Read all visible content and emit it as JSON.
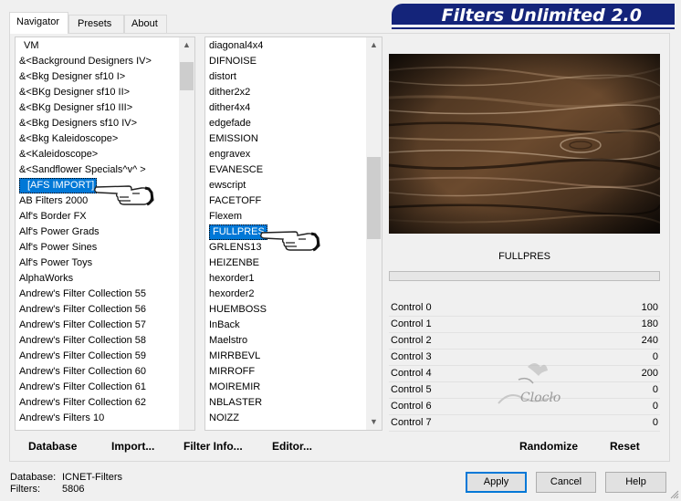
{
  "app": {
    "title": "Filters Unlimited 2.0"
  },
  "tabs": [
    {
      "label": "Navigator",
      "active": true
    },
    {
      "label": "Presets",
      "active": false
    },
    {
      "label": "About",
      "active": false
    }
  ],
  "categories": {
    "items": [
      "VM",
      "&<Background Designers IV>",
      "&<Bkg Designer sf10 I>",
      "&<BKg Designer sf10 II>",
      "&<BKg Designer sf10 III>",
      "&<Bkg Designers sf10 IV>",
      "&<Bkg Kaleidoscope>",
      "&<Kaleidoscope>",
      "&<Sandflower Specials^v^ >",
      "[AFS IMPORT]",
      "AB Filters 2000",
      "Alf's Border FX",
      "Alf's Power Grads",
      "Alf's Power Sines",
      "Alf's Power Toys",
      "AlphaWorks",
      "Andrew's Filter Collection 55",
      "Andrew's Filter Collection 56",
      "Andrew's Filter Collection 57",
      "Andrew's Filter Collection 58",
      "Andrew's Filter Collection 59",
      "Andrew's Filter Collection 60",
      "Andrew's Filter Collection 61",
      "Andrew's Filter Collection 62",
      "Andrew's Filters 10"
    ],
    "selected": "[AFS IMPORT]"
  },
  "filters": {
    "items": [
      "diagonal4x4",
      "DIFNOISE",
      "distort",
      "dither2x2",
      "dither4x4",
      "edgefade",
      "EMISSION",
      "engravex",
      "EVANESCE",
      "ewscript",
      "FACETOFF",
      "Flexem",
      "FULLPRES",
      "GRLENS13",
      "HEIZENBE",
      "hexorder1",
      "hexorder2",
      "HUEMBOSS",
      "InBack",
      "Maelstro",
      "MIRRBEVL",
      "MIRROFF",
      "MOIREMIR",
      "NBLASTER",
      "NOIZZ"
    ],
    "selected": "FULLPRES"
  },
  "preview": {
    "filter_name": "FULLPRES",
    "watermark": "Cloclo"
  },
  "controls": [
    {
      "name": "Control 0",
      "value": "100"
    },
    {
      "name": "Control 1",
      "value": "180"
    },
    {
      "name": "Control 2",
      "value": "240"
    },
    {
      "name": "Control 3",
      "value": "0"
    },
    {
      "name": "Control 4",
      "value": "200"
    },
    {
      "name": "Control 5",
      "value": "0"
    },
    {
      "name": "Control 6",
      "value": "0"
    },
    {
      "name": "Control 7",
      "value": "0"
    }
  ],
  "toolbar": {
    "database": "Database",
    "import": "Import...",
    "filter_info": "Filter Info...",
    "editor": "Editor...",
    "randomize": "Randomize",
    "reset": "Reset"
  },
  "status": {
    "database_label": "Database:",
    "database_value": "ICNET-Filters",
    "filters_label": "Filters:",
    "filters_value": "5806"
  },
  "buttons": {
    "apply": "Apply",
    "cancel": "Cancel",
    "help": "Help"
  },
  "colors": {
    "title_banner": "#14247a",
    "selection": "#0078d7"
  }
}
